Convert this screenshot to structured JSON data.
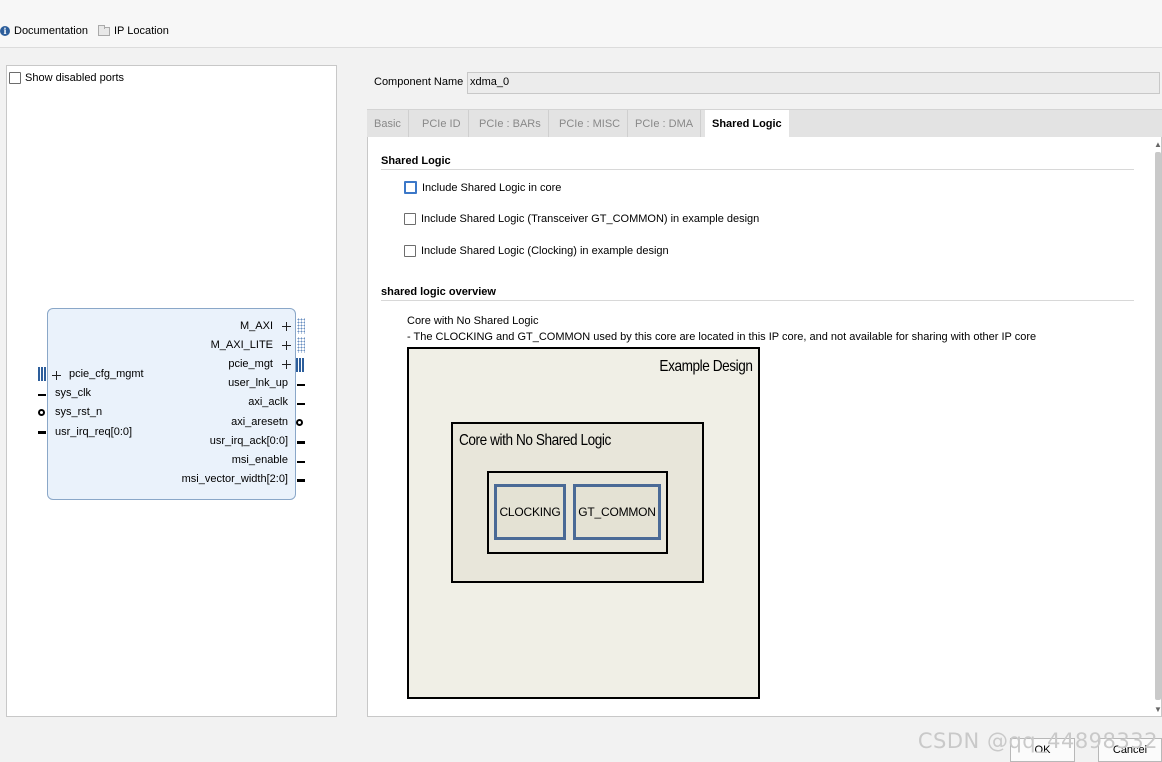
{
  "toolbar": {
    "documentation_label": "Documentation",
    "ip_location_label": "IP Location"
  },
  "left_panel": {
    "show_disabled_ports_label": "Show disabled ports"
  },
  "symbol": {
    "right_ports": [
      "M_AXI",
      "M_AXI_LITE",
      "pcie_mgt",
      "user_lnk_up",
      "axi_aclk",
      "axi_aresetn",
      "usr_irq_ack[0:0]",
      "msi_enable",
      "msi_vector_width[2:0]"
    ],
    "left_ports": [
      "pcie_cfg_mgmt",
      "sys_clk",
      "sys_rst_n",
      "usr_irq_req[0:0]"
    ]
  },
  "component": {
    "name_label": "Component Name",
    "name_value": "xdma_0"
  },
  "tabs": [
    {
      "label": "Basic"
    },
    {
      "label": "PCIe ID"
    },
    {
      "label": "PCIe : BARs"
    },
    {
      "label": "PCIe : MISC"
    },
    {
      "label": "PCIe : DMA"
    },
    {
      "label": "Shared Logic"
    }
  ],
  "active_tab": "Shared Logic",
  "shared_logic": {
    "title": "Shared Logic",
    "options": [
      "Include Shared Logic in core",
      "Include Shared Logic (Transceiver GT_COMMON) in example design",
      "Include Shared Logic (Clocking) in example design"
    ]
  },
  "overview": {
    "title": "shared logic overview",
    "desc_line1": "Core with No Shared Logic",
    "desc_line2": "- The CLOCKING and GT_COMMON used by this core are located in this IP core, and not available for sharing with other IP core"
  },
  "diagram": {
    "outer_title": "Example Design",
    "mid_title": "Core with No Shared Logic",
    "box1": "CLOCKING",
    "box2": "GT_COMMON"
  },
  "footer": {
    "watermark": "CSDN @qq_44898332",
    "ok_label": "OK",
    "cancel_label": "Cancel"
  },
  "colors": {
    "accent": "#3c78c8",
    "ip_block_fill": "#eaf2fb",
    "diagram_box_border": "#4a6a96"
  }
}
